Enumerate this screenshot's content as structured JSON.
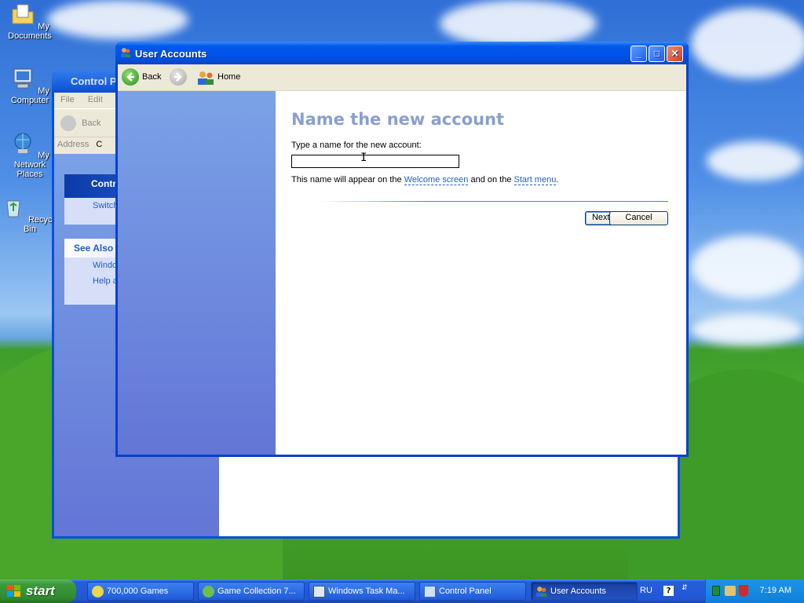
{
  "desktop": {
    "icons": [
      {
        "label": "My Documents",
        "icon": "folder-documents-icon"
      },
      {
        "label": "My Computer",
        "icon": "computer-icon"
      },
      {
        "label": "My Network Places",
        "icon": "network-icon"
      },
      {
        "label": "Recycle Bin",
        "icon": "recycle-bin-icon"
      }
    ]
  },
  "bg_window": {
    "title": "Control P",
    "menu": [
      "File",
      "Edit"
    ],
    "back_label": "Back",
    "address_label": "Address",
    "address_value": "C",
    "panel1_title": "Contr",
    "panel1_item": "Switch",
    "see_also_title": "See Also",
    "see_also_items": [
      "Windo",
      "Help a"
    ]
  },
  "window": {
    "title": "User Accounts",
    "toolbar": {
      "back_label": "Back",
      "home_label": "Home"
    },
    "heading": "Name the new account",
    "prompt": "Type a name for the new account:",
    "name_value": "",
    "info_before": "This name will appear on the ",
    "welcome_link": "Welcome screen",
    "info_middle": " and on the ",
    "start_menu_link": "Start menu",
    "info_after": ".",
    "next_label": "Next >",
    "cancel_label": "Cancel"
  },
  "taskbar": {
    "start_label": "start",
    "tasks": [
      {
        "label": "700,000 Games",
        "active": false
      },
      {
        "label": "Game Collection 7...",
        "active": false
      },
      {
        "label": "Windows Task Ma...",
        "active": false
      },
      {
        "label": "Control Panel",
        "active": false
      },
      {
        "label": "User Accounts",
        "active": true
      }
    ],
    "language": "RU",
    "clock": "7:19 AM"
  },
  "colors": {
    "heading": "#8a9fcf",
    "link": "#215dc6",
    "titlebar": "#0050e6",
    "sidebar": "#6f8ee0"
  }
}
